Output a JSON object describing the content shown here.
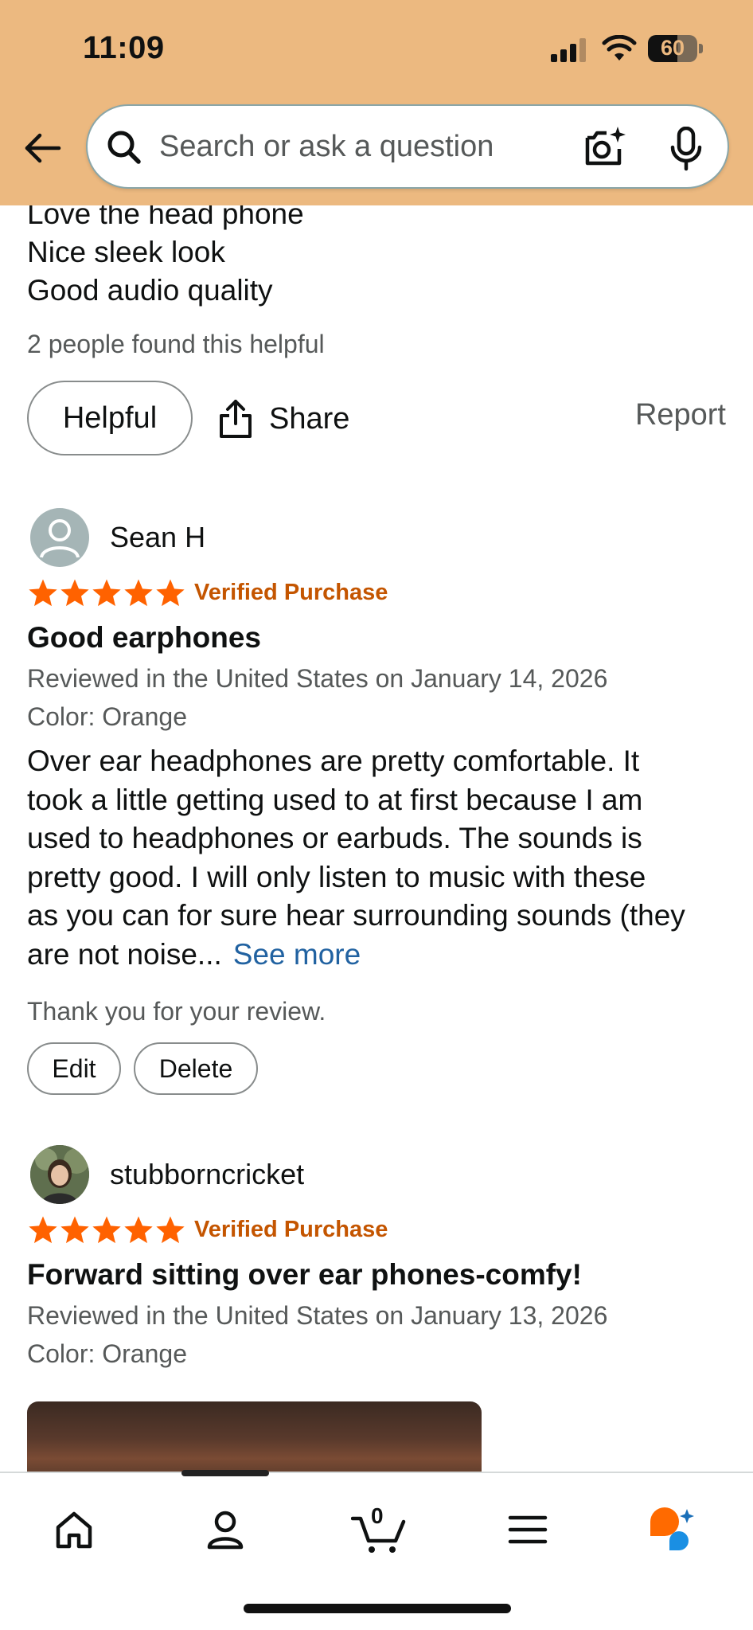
{
  "status_bar": {
    "time": "11:09",
    "battery": "60",
    "battery_fraction": 0.6
  },
  "header": {
    "search_placeholder": "Search or ask a question",
    "bg_color": "#ecb980"
  },
  "previous_review": {
    "lines": [
      "Love the head phone",
      "Nice sleek look",
      "Good audio quality"
    ],
    "helpful_count": "2 people found this helpful",
    "helpful_label": "Helpful",
    "share_label": "Share",
    "report_label": "Report"
  },
  "reviews": [
    {
      "reviewer": "Sean H",
      "rating": 5,
      "verified": "Verified Purchase",
      "title": "Good earphones",
      "meta": "Reviewed in the United States on January 14, 2026",
      "color": "Color: Orange",
      "body_lines": [
        "Over ear headphones are pretty comfortable. It",
        "took a little getting used to at first because I am",
        "used to headphones or earbuds. The sounds is",
        "pretty good. I will only listen to music with these",
        "as you can for sure hear surrounding sounds (they",
        "are not noise..."
      ],
      "see_more": "See more",
      "thanks": "Thank you for your review.",
      "edit_label": "Edit",
      "delete_label": "Delete"
    },
    {
      "reviewer": "stubborncricket",
      "rating": 5,
      "verified": "Verified Purchase",
      "title": "Forward sitting over ear phones-comfy!",
      "meta": "Reviewed in the United States on January 13, 2026",
      "color": "Color: Orange"
    }
  ],
  "bottom_nav": {
    "cart_count": "0",
    "items": [
      "home-icon",
      "account-icon",
      "cart-icon",
      "menu-icon",
      "rufus-icon"
    ]
  },
  "colors": {
    "star": "#ff6200",
    "verified": "#c45500",
    "link": "#2162a1"
  }
}
